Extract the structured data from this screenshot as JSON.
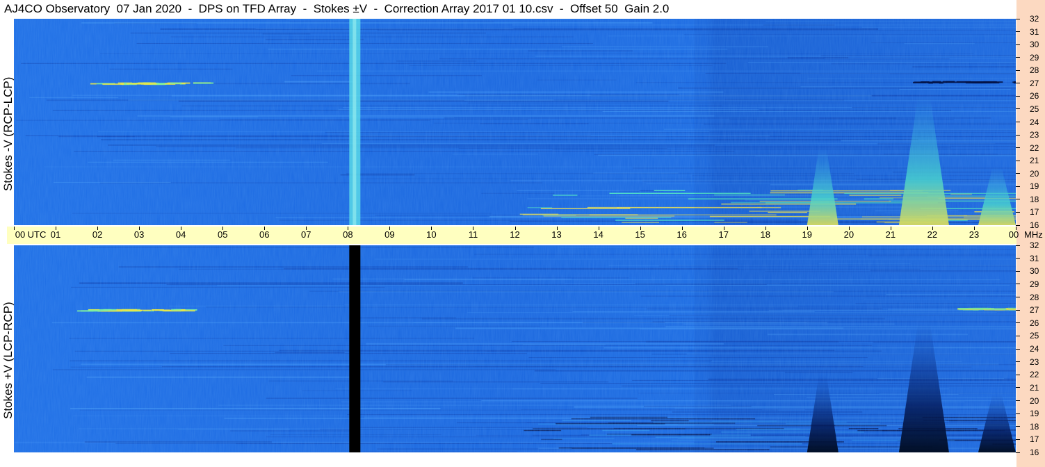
{
  "header": {
    "title": "AJ4CO Observatory  07 Jan 2020  -  DPS on TFD Array  -  Stokes ±V  -  Correction Array 2017 01 10.csv  -  Offset 50  Gain 2.0"
  },
  "colors": {
    "background_blue": "#1c6ce6",
    "dark_blue": "#0a2a8a",
    "cyan": "#3fd6e8",
    "yellow": "#e8e24a",
    "time_axis_bg": "#ffffc0",
    "freq_axis_bg": "#fcd9c1"
  },
  "chart_data": [
    {
      "type": "heatmap",
      "panel": "top",
      "ylabel": "Stokes -V (RCP-LCP)",
      "x_unit": "UTC",
      "y_unit": "MHz",
      "xlim": [
        0,
        24
      ],
      "ylim": [
        16,
        32
      ],
      "x_ticks": [
        "00",
        "01",
        "02",
        "03",
        "04",
        "05",
        "06",
        "07",
        "08",
        "09",
        "10",
        "11",
        "12",
        "13",
        "14",
        "15",
        "16",
        "17",
        "18",
        "19",
        "20",
        "21",
        "22",
        "23",
        "00"
      ],
      "y_ticks": [
        16,
        17,
        18,
        19,
        20,
        21,
        22,
        23,
        24,
        25,
        26,
        27,
        28,
        29,
        30,
        31,
        32
      ],
      "features": [
        {
          "kind": "vertical_band",
          "t": 8.15,
          "tone": "cyan"
        },
        {
          "kind": "emission",
          "t_start": 19.0,
          "t_end": 19.75,
          "f_low": 16,
          "f_high": 22,
          "tone": "bright"
        },
        {
          "kind": "emission",
          "t_start": 21.2,
          "t_end": 22.4,
          "f_low": 16,
          "f_high": 26,
          "tone": "bright"
        },
        {
          "kind": "emission",
          "t_start": 23.1,
          "t_end": 24.0,
          "f_low": 16,
          "f_high": 20.5,
          "tone": "bright"
        },
        {
          "kind": "line",
          "t_start": 1.5,
          "t_end": 4.3,
          "f": 27,
          "tone": "bright"
        },
        {
          "kind": "line",
          "t_start": 21.5,
          "t_end": 24.0,
          "f": 27.1,
          "tone": "dark"
        }
      ]
    },
    {
      "type": "heatmap",
      "panel": "bottom",
      "ylabel": "Stokes +V (LCP-RCP)",
      "x_unit": "UTC",
      "y_unit": "MHz",
      "xlim": [
        0,
        24
      ],
      "ylim": [
        16,
        32
      ],
      "y_ticks": [
        16,
        17,
        18,
        19,
        20,
        21,
        22,
        23,
        24,
        25,
        26,
        27,
        28,
        29,
        30,
        31,
        32
      ],
      "features": [
        {
          "kind": "vertical_band",
          "t": 8.15,
          "tone": "black"
        },
        {
          "kind": "emission",
          "t_start": 19.0,
          "t_end": 19.75,
          "f_low": 16,
          "f_high": 22,
          "tone": "dark"
        },
        {
          "kind": "emission",
          "t_start": 21.2,
          "t_end": 22.4,
          "f_low": 16,
          "f_high": 26,
          "tone": "dark"
        },
        {
          "kind": "emission",
          "t_start": 23.1,
          "t_end": 24.0,
          "f_low": 16,
          "f_high": 20.5,
          "tone": "dark"
        },
        {
          "kind": "line",
          "t_start": 1.5,
          "t_end": 4.3,
          "f": 27,
          "tone": "bright"
        },
        {
          "kind": "line",
          "t_start": 22.6,
          "t_end": 24.0,
          "f": 27.1,
          "tone": "bright"
        }
      ]
    }
  ]
}
